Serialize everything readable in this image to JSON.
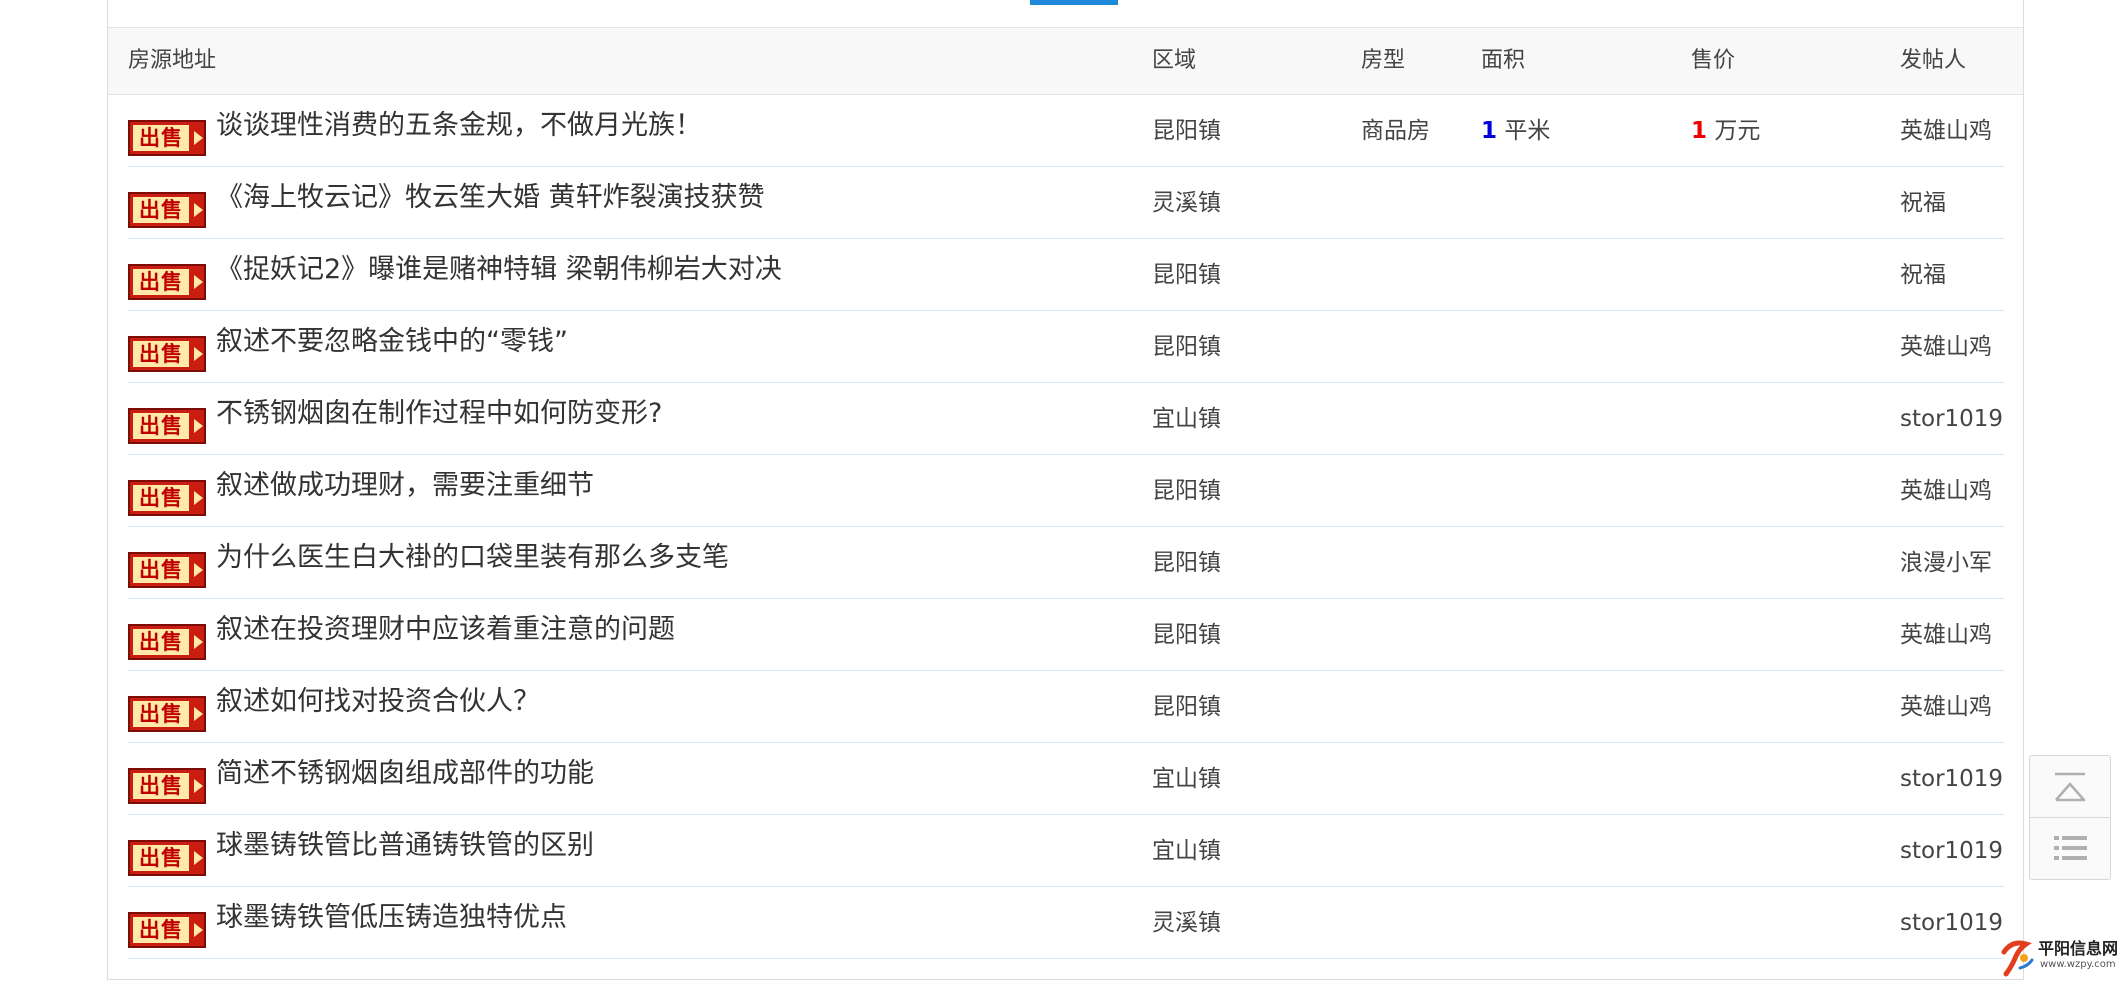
{
  "table": {
    "headers": {
      "address": "房源地址",
      "area": "区域",
      "type": "房型",
      "size": "面积",
      "price": "售价",
      "poster": "发帖人"
    },
    "badge_text": "出售",
    "rows": [
      {
        "title": "谈谈理性消费的五条金规，不做月光族！",
        "area": "昆阳镇",
        "type": "商品房",
        "size_value": "1",
        "size_unit": "平米",
        "price_value": "1",
        "price_unit": "万元",
        "poster": "英雄山鸡"
      },
      {
        "title": "《海上牧云记》牧云笙大婚 黄轩炸裂演技获赞",
        "area": "灵溪镇",
        "type": "",
        "size_value": "",
        "size_unit": "",
        "price_value": "",
        "price_unit": "",
        "poster": "祝福"
      },
      {
        "title": "《捉妖记2》曝谁是赌神特辑 梁朝伟柳岩大对决",
        "area": "昆阳镇",
        "type": "",
        "size_value": "",
        "size_unit": "",
        "price_value": "",
        "price_unit": "",
        "poster": "祝福"
      },
      {
        "title": "叙述不要忽略金钱中的“零钱”",
        "area": "昆阳镇",
        "type": "",
        "size_value": "",
        "size_unit": "",
        "price_value": "",
        "price_unit": "",
        "poster": "英雄山鸡"
      },
      {
        "title": "不锈钢烟囱在制作过程中如何防变形?",
        "area": "宜山镇",
        "type": "",
        "size_value": "",
        "size_unit": "",
        "price_value": "",
        "price_unit": "",
        "poster": "stor1019"
      },
      {
        "title": "叙述做成功理财，需要注重细节",
        "area": "昆阳镇",
        "type": "",
        "size_value": "",
        "size_unit": "",
        "price_value": "",
        "price_unit": "",
        "poster": "英雄山鸡"
      },
      {
        "title": "为什么医生白大褂的口袋里装有那么多支笔",
        "area": "昆阳镇",
        "type": "",
        "size_value": "",
        "size_unit": "",
        "price_value": "",
        "price_unit": "",
        "poster": "浪漫小军"
      },
      {
        "title": "叙述在投资理财中应该着重注意的问题",
        "area": "昆阳镇",
        "type": "",
        "size_value": "",
        "size_unit": "",
        "price_value": "",
        "price_unit": "",
        "poster": "英雄山鸡"
      },
      {
        "title": "叙述如何找对投资合伙人？",
        "area": "昆阳镇",
        "type": "",
        "size_value": "",
        "size_unit": "",
        "price_value": "",
        "price_unit": "",
        "poster": "英雄山鸡"
      },
      {
        "title": "简述不锈钢烟囱组成部件的功能",
        "area": "宜山镇",
        "type": "",
        "size_value": "",
        "size_unit": "",
        "price_value": "",
        "price_unit": "",
        "poster": "stor1019"
      },
      {
        "title": "球墨铸铁管比普通铸铁管的区别",
        "area": "宜山镇",
        "type": "",
        "size_value": "",
        "size_unit": "",
        "price_value": "",
        "price_unit": "",
        "poster": "stor1019"
      },
      {
        "title": "球墨铸铁管低压铸造独特优点",
        "area": "灵溪镇",
        "type": "",
        "size_value": "",
        "size_unit": "",
        "price_value": "",
        "price_unit": "",
        "poster": "stor1019"
      }
    ]
  },
  "side_tools": {
    "back_to_top_icon": "back-to-top-icon",
    "list_icon": "list-icon"
  },
  "logo": {
    "name": "平阳信息网",
    "url_text": "www.wzpy.com"
  },
  "colors": {
    "accent": "#1e88d9",
    "badge_red": "#c81d10",
    "badge_fill": "#ffe9a8",
    "size_number": "#0000dd",
    "price_number": "#ee0000",
    "row_divider": "#d4e6f1"
  }
}
